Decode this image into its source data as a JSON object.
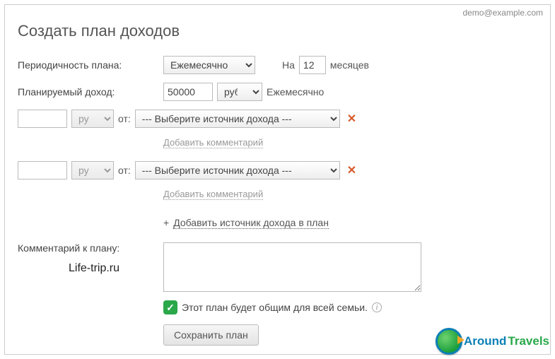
{
  "header": {
    "email": "demo@example.com",
    "title": "Создать план доходов"
  },
  "form": {
    "period_label": "Периодичность плана:",
    "period_value": "Ежемесячно",
    "na_label": "На",
    "months_value": "12",
    "months_label": "месяцев",
    "income_label": "Планируемый доход:",
    "income_value": "50000",
    "currency_value": "руб",
    "income_period": "Ежемесячно",
    "rows": [
      {
        "amount": "",
        "currency": "руб",
        "ot": "от:",
        "source": "--- Выберите источник дохода ---",
        "add_comment": "Добавить комментарий"
      },
      {
        "amount": "",
        "currency": "руб",
        "ot": "от:",
        "source": "--- Выберите источник дохода ---",
        "add_comment": "Добавить комментарий"
      }
    ],
    "add_source_plus": "+",
    "add_source": "Добавить источник дохода в план",
    "comment_label": "Комментарий к плану:",
    "comment_value": "",
    "share_label": "Этот план будет общим для всей семьи.",
    "save_label": "Сохранить план"
  },
  "watermark": "Life-trip.ru",
  "logo": {
    "t1": "Around",
    "t2": "Travels"
  }
}
